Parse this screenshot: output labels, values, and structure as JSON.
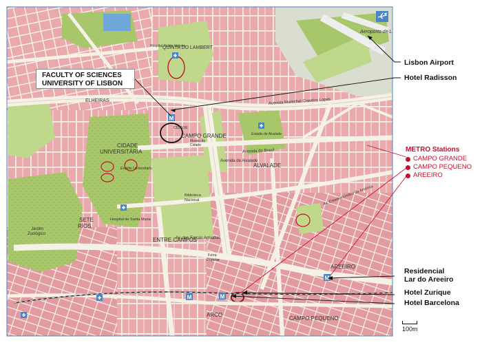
{
  "map": {
    "faculty_label_line1": "FACULTY OF SCIENCES",
    "faculty_label_line2": "UNIVERSITY OF LISBON",
    "annotations": {
      "airport": "Lisbon Airport",
      "radisson": "Hotel Radisson",
      "residencial_line1": "Residencial",
      "residencial_line2": "Lar do Areeiro",
      "zurique": "Hotel Zurique",
      "barcelona": "Hotel Barcelona"
    },
    "metro": {
      "title": "METRO Stations",
      "stations": [
        "CAMPO GRANDE",
        "CAMPO PEQUENO",
        "AREEIRO"
      ]
    },
    "scale_label": "100m",
    "map_labels": {
      "airport": "Aeroporto de L",
      "quinta_lambert": "QUINTA DO LAMBERT",
      "campo_grande": "CAMPO GRANDE",
      "cidade_universitaria_1": "CIDADE",
      "cidade_universitaria_2": "UNIVERSITÁRIA",
      "alvalade": "ALVALADE",
      "sete_rios_1": "SETE",
      "sete_rios_2": "RIOS",
      "entre_campos": "ENTRE CAMPOS",
      "areeiro": "AREEIRO",
      "campo_pequeno": "CAMPO PEQUENO",
      "arco": "ARCO",
      "av_brasil": "Avenida do Brasil",
      "av_alvalade": "Avenida de Alvalade",
      "av_forcas_armadas": "Av. das Forças Armadas",
      "av_marechal": "Avenida Marechal Craveiro Lopes",
      "av_ej": "Av. Estados Unidos da América",
      "hospital_st_maria": "Hospital de Santa Maria",
      "estadio_alvalade": "Estádio de Alvalade",
      "estadio_universitario": "Estádio Universitário",
      "jardim_zoologico_1": "Jardim",
      "jardim_zoologico_2": "Zoológico",
      "biblioteca_1": "Biblioteca",
      "biblioteca_2": "Nacional",
      "cidade_label": "CIDADE",
      "feira_popular_1": "Feira",
      "feira_popular_2": "Popular",
      "campo_grande_museum_1": "Museu da",
      "campo_grande_museum_2": "Cidade",
      "hospital_pulido": "Hospital Pulido Valente",
      "elheiras": "ELHEIRAS"
    }
  },
  "colors": {
    "block_pink": "#e9a9ad",
    "block_pink_dark": "#dc8e94",
    "street": "#f5f1e6",
    "park_green": "#a8c66a",
    "park_green_light": "#bfd88c",
    "water_blue": "#6fa8d8",
    "metro_red": "#c8102e",
    "map_frame": "#4a86c7"
  }
}
